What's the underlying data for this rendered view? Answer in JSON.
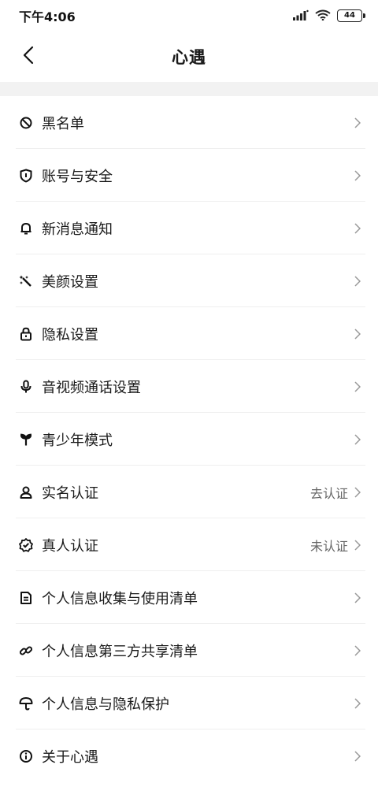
{
  "status_bar": {
    "time": "下午4:06",
    "battery": "44"
  },
  "header": {
    "title": "心遇",
    "back_icon": "chevron-left-icon"
  },
  "items": [
    {
      "label": "黑名单",
      "icon": "block-icon",
      "value": ""
    },
    {
      "label": "账号与安全",
      "icon": "shield-icon",
      "value": ""
    },
    {
      "label": "新消息通知",
      "icon": "bell-icon",
      "value": ""
    },
    {
      "label": "美颜设置",
      "icon": "beauty-wand-icon",
      "value": ""
    },
    {
      "label": "隐私设置",
      "icon": "lock-icon",
      "value": ""
    },
    {
      "label": "音视频通话设置",
      "icon": "microphone-icon",
      "value": ""
    },
    {
      "label": "青少年模式",
      "icon": "sprout-icon",
      "value": ""
    },
    {
      "label": "实名认证",
      "icon": "person-icon",
      "value": "去认证"
    },
    {
      "label": "真人认证",
      "icon": "verified-badge-icon",
      "value": "未认证"
    },
    {
      "label": "个人信息收集与使用清单",
      "icon": "document-icon",
      "value": ""
    },
    {
      "label": "个人信息第三方共享清单",
      "icon": "link-icon",
      "value": ""
    },
    {
      "label": "个人信息与隐私保护",
      "icon": "umbrella-icon",
      "value": ""
    },
    {
      "label": "关于心遇",
      "icon": "info-icon",
      "value": ""
    }
  ]
}
